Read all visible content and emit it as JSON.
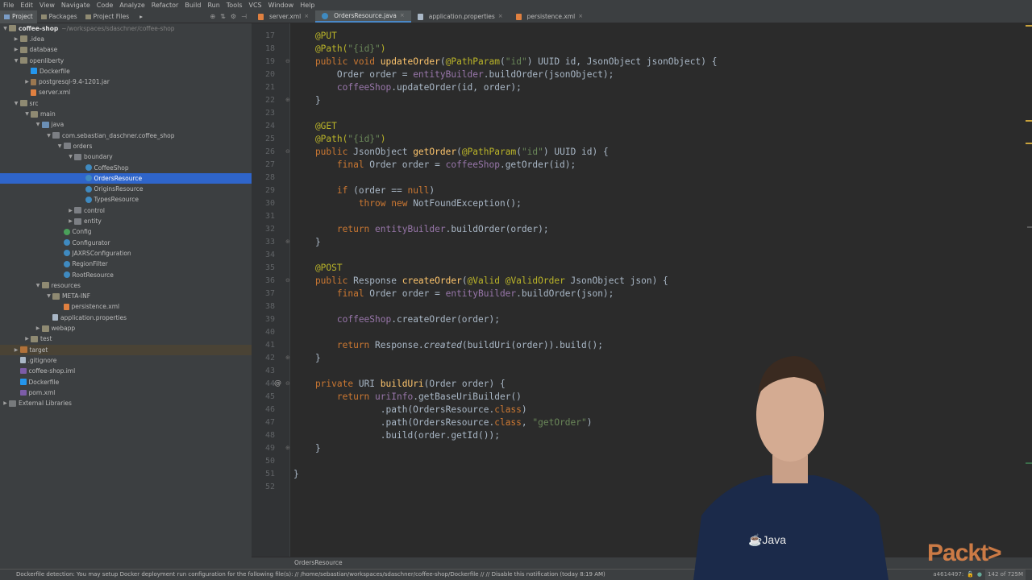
{
  "menu": [
    "File",
    "Edit",
    "View",
    "Navigate",
    "Code",
    "Analyze",
    "Refactor",
    "Build",
    "Run",
    "Tools",
    "VCS",
    "Window",
    "Help"
  ],
  "toolwin": {
    "tabs": [
      "Project",
      "Packages",
      "Project Files"
    ]
  },
  "tree": [
    {
      "indent": 0,
      "arrow": "down",
      "icon": "folder",
      "label": "coffee-shop",
      "path": "~/workspaces/sdaschner/coffee-shop",
      "bold": true
    },
    {
      "indent": 1,
      "arrow": "right",
      "icon": "folder",
      "label": ".idea"
    },
    {
      "indent": 1,
      "arrow": "right",
      "icon": "folder",
      "label": "database"
    },
    {
      "indent": 1,
      "arrow": "down",
      "icon": "folder",
      "label": "openliberty"
    },
    {
      "indent": 2,
      "arrow": "",
      "icon": "docker",
      "label": "Dockerfile"
    },
    {
      "indent": 2,
      "arrow": "right",
      "icon": "jar",
      "label": "postgresql-9.4-1201.jar"
    },
    {
      "indent": 2,
      "arrow": "",
      "icon": "xml",
      "label": "server.xml"
    },
    {
      "indent": 1,
      "arrow": "down",
      "icon": "folder",
      "label": "src"
    },
    {
      "indent": 2,
      "arrow": "down",
      "icon": "folder",
      "label": "main"
    },
    {
      "indent": 3,
      "arrow": "down",
      "icon": "src",
      "label": "java"
    },
    {
      "indent": 4,
      "arrow": "down",
      "icon": "pkg",
      "label": "com.sebastian_daschner.coffee_shop"
    },
    {
      "indent": 5,
      "arrow": "down",
      "icon": "pkg",
      "label": "orders"
    },
    {
      "indent": 6,
      "arrow": "down",
      "icon": "pkg",
      "label": "boundary"
    },
    {
      "indent": 7,
      "arrow": "",
      "icon": "class",
      "label": "CoffeeShop"
    },
    {
      "indent": 7,
      "arrow": "",
      "icon": "class",
      "label": "OrdersResource",
      "selected": true
    },
    {
      "indent": 7,
      "arrow": "",
      "icon": "class",
      "label": "OriginsResource"
    },
    {
      "indent": 7,
      "arrow": "",
      "icon": "class",
      "label": "TypesResource"
    },
    {
      "indent": 6,
      "arrow": "right",
      "icon": "pkg",
      "label": "control"
    },
    {
      "indent": 6,
      "arrow": "right",
      "icon": "pkg",
      "label": "entity"
    },
    {
      "indent": 5,
      "arrow": "",
      "icon": "config",
      "label": "Config"
    },
    {
      "indent": 5,
      "arrow": "",
      "icon": "class",
      "label": "Configurator"
    },
    {
      "indent": 5,
      "arrow": "",
      "icon": "class",
      "label": "JAXRSConfiguration"
    },
    {
      "indent": 5,
      "arrow": "",
      "icon": "class",
      "label": "RegionFilter"
    },
    {
      "indent": 5,
      "arrow": "",
      "icon": "class",
      "label": "RootResource"
    },
    {
      "indent": 3,
      "arrow": "down",
      "icon": "folder",
      "label": "resources"
    },
    {
      "indent": 4,
      "arrow": "down",
      "icon": "folder",
      "label": "META-INF"
    },
    {
      "indent": 5,
      "arrow": "",
      "icon": "xml",
      "label": "persistence.xml"
    },
    {
      "indent": 4,
      "arrow": "",
      "icon": "file",
      "label": "application.properties"
    },
    {
      "indent": 3,
      "arrow": "right",
      "icon": "folder",
      "label": "webapp"
    },
    {
      "indent": 2,
      "arrow": "right",
      "icon": "folder",
      "label": "test"
    },
    {
      "indent": 1,
      "arrow": "right",
      "icon": "orange",
      "label": "target",
      "hilite": true
    },
    {
      "indent": 1,
      "arrow": "",
      "icon": "file",
      "label": ".gitignore"
    },
    {
      "indent": 1,
      "arrow": "",
      "icon": "mvn",
      "label": "coffee-shop.iml"
    },
    {
      "indent": 1,
      "arrow": "",
      "icon": "docker",
      "label": "Dockerfile"
    },
    {
      "indent": 1,
      "arrow": "",
      "icon": "mvn",
      "label": "pom.xml"
    },
    {
      "indent": 0,
      "arrow": "right",
      "icon": "lib",
      "label": "External Libraries"
    }
  ],
  "editor_tabs": [
    {
      "label": "server.xml",
      "active": false
    },
    {
      "label": "OrdersResource.java",
      "active": true
    },
    {
      "label": "application.properties",
      "active": false
    },
    {
      "label": "persistence.xml",
      "active": false
    }
  ],
  "code": [
    {
      "n": "17",
      "segs": [
        [
          "an",
          "    @PUT"
        ]
      ]
    },
    {
      "n": "18",
      "segs": [
        [
          "an",
          "    @Path("
        ],
        [
          "str",
          "\"{id}\""
        ],
        [
          "an",
          ")"
        ]
      ]
    },
    {
      "n": "19",
      "segs": [
        [
          "kw",
          "    public void "
        ],
        [
          "mth",
          "updateOrder"
        ],
        [
          "",
          "("
        ],
        [
          "an",
          "@PathParam"
        ],
        [
          "",
          "("
        ],
        [
          "str",
          "\"id\""
        ],
        [
          "",
          ") UUID id, JsonObject jsonObject) {"
        ]
      ]
    },
    {
      "n": "20",
      "segs": [
        [
          "",
          "        Order order = "
        ],
        [
          "fld",
          "entityBuilder"
        ],
        [
          "",
          ".buildOrder(jsonObject);"
        ]
      ]
    },
    {
      "n": "21",
      "segs": [
        [
          "fld",
          "        coffeeShop"
        ],
        [
          "",
          ".updateOrder(id, order);"
        ]
      ]
    },
    {
      "n": "22",
      "segs": [
        [
          "",
          "    }"
        ]
      ]
    },
    {
      "n": "23",
      "segs": []
    },
    {
      "n": "24",
      "segs": [
        [
          "an",
          "    @GET"
        ]
      ]
    },
    {
      "n": "25",
      "segs": [
        [
          "an",
          "    @Path("
        ],
        [
          "str",
          "\"{id}\""
        ],
        [
          "an",
          ")"
        ]
      ]
    },
    {
      "n": "26",
      "segs": [
        [
          "kw",
          "    public "
        ],
        [
          "",
          "JsonObject "
        ],
        [
          "mth",
          "getOrder"
        ],
        [
          "",
          "("
        ],
        [
          "an",
          "@PathParam"
        ],
        [
          "",
          "("
        ],
        [
          "str",
          "\"id\""
        ],
        [
          "",
          ") UUID id) {"
        ]
      ]
    },
    {
      "n": "27",
      "segs": [
        [
          "kw",
          "        final "
        ],
        [
          "",
          "Order order = "
        ],
        [
          "fld",
          "coffeeShop"
        ],
        [
          "",
          ".getOrder(id);"
        ]
      ]
    },
    {
      "n": "28",
      "segs": []
    },
    {
      "n": "29",
      "segs": [
        [
          "kw",
          "        if "
        ],
        [
          "",
          "(order == "
        ],
        [
          "kw",
          "null"
        ],
        [
          "",
          ")"
        ]
      ]
    },
    {
      "n": "30",
      "segs": [
        [
          "kw",
          "            throw new "
        ],
        [
          "",
          "NotFoundException();"
        ]
      ]
    },
    {
      "n": "31",
      "segs": []
    },
    {
      "n": "32",
      "segs": [
        [
          "kw",
          "        return "
        ],
        [
          "fld",
          "entityBuilder"
        ],
        [
          "",
          ".buildOrder(order);"
        ]
      ]
    },
    {
      "n": "33",
      "segs": [
        [
          "",
          "    }"
        ]
      ]
    },
    {
      "n": "34",
      "segs": []
    },
    {
      "n": "35",
      "segs": [
        [
          "an",
          "    @POST"
        ]
      ]
    },
    {
      "n": "36",
      "segs": [
        [
          "kw",
          "    public "
        ],
        [
          "",
          "Response "
        ],
        [
          "mth",
          "createOrder"
        ],
        [
          "",
          "("
        ],
        [
          "an",
          "@Valid @ValidOrder "
        ],
        [
          "",
          "JsonObject json) {"
        ]
      ]
    },
    {
      "n": "37",
      "segs": [
        [
          "kw",
          "        final "
        ],
        [
          "",
          "Order order = "
        ],
        [
          "fld",
          "entityBuilder"
        ],
        [
          "",
          ".buildOrder(json);"
        ]
      ]
    },
    {
      "n": "38",
      "segs": []
    },
    {
      "n": "39",
      "segs": [
        [
          "fld",
          "        coffeeShop"
        ],
        [
          "",
          ".createOrder(order);"
        ]
      ]
    },
    {
      "n": "40",
      "segs": []
    },
    {
      "n": "41",
      "segs": [
        [
          "kw",
          "        return "
        ],
        [
          "",
          "Response."
        ],
        [
          "it",
          "created"
        ],
        [
          "",
          "(buildUri(order)).build();"
        ]
      ]
    },
    {
      "n": "42",
      "segs": [
        [
          "",
          "    }"
        ]
      ]
    },
    {
      "n": "43",
      "segs": []
    },
    {
      "n": "44",
      "segs": [
        [
          "kw",
          "    private "
        ],
        [
          "",
          "URI "
        ],
        [
          "mth",
          "buildUri"
        ],
        [
          "",
          "(Order order) {"
        ]
      ]
    },
    {
      "n": "45",
      "segs": [
        [
          "kw",
          "        return "
        ],
        [
          "fld",
          "uriInfo"
        ],
        [
          "",
          ".getBaseUriBuilder()"
        ]
      ]
    },
    {
      "n": "46",
      "segs": [
        [
          "",
          "                .path(OrdersResource."
        ],
        [
          "kw",
          "class"
        ],
        [
          "",
          ")"
        ]
      ]
    },
    {
      "n": "47",
      "segs": [
        [
          "",
          "                .path(OrdersResource."
        ],
        [
          "kw",
          "class"
        ],
        [
          ", ",
          ", "
        ],
        [
          "str",
          "\"getOrder\""
        ],
        [
          "",
          ")"
        ]
      ]
    },
    {
      "n": "48",
      "segs": [
        [
          "",
          "                .build(order.getId());"
        ]
      ]
    },
    {
      "n": "49",
      "segs": [
        [
          "",
          "    }"
        ]
      ]
    },
    {
      "n": "50",
      "segs": []
    },
    {
      "n": "51",
      "segs": [
        [
          "",
          "}"
        ]
      ]
    },
    {
      "n": "52",
      "segs": []
    }
  ],
  "breadcrumb": "OrdersResource",
  "status": {
    "message": "Dockerfile detection: You may setup Docker deployment run configuration for the following file(s): // /home/sebastian/workspaces/sdaschner/coffee-shop/Dockerfile // // Disable this notification (today 8:19 AM)",
    "position": "a4614497:",
    "memory": "142 of 725M"
  },
  "logo": "Packt>"
}
